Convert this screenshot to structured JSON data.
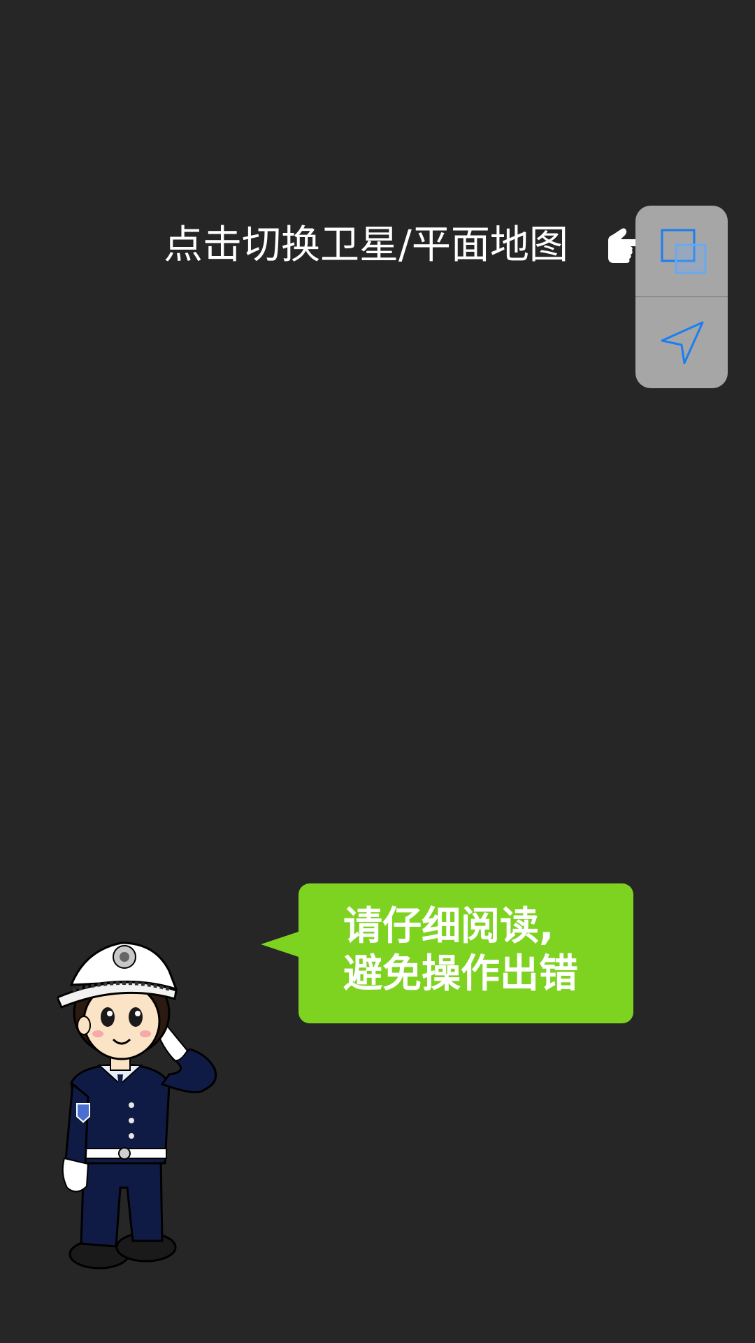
{
  "hint": {
    "text": "点击切换卫星/平面地图",
    "pointer_icon": "pointing-hand-icon"
  },
  "map_controls": {
    "layer_switch_icon": "map-layer-toggle-icon",
    "locate_icon": "navigation-arrow-icon",
    "accent_color": "#1a7ef2"
  },
  "mascot": {
    "description_icon": "police-officer-saluting-illustration"
  },
  "bubble": {
    "line1": "请仔细阅读,",
    "line2": "避免操作出错",
    "color": "#7ed321"
  },
  "colors": {
    "background": "#262626",
    "panel": "#a6a6a6"
  }
}
